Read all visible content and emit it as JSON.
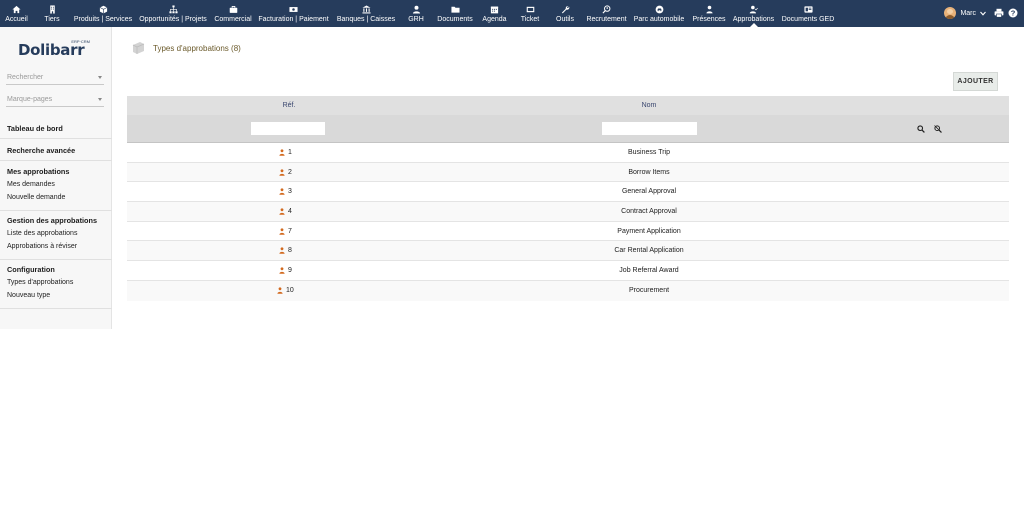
{
  "nav": [
    {
      "label": "Accueil",
      "icon": "home-icon"
    },
    {
      "label": "Tiers",
      "icon": "building-icon"
    },
    {
      "label": "Produits | Services",
      "icon": "cube-icon"
    },
    {
      "label": "Opportunités | Projets",
      "icon": "sitemap-icon"
    },
    {
      "label": "Commercial",
      "icon": "briefcase-icon"
    },
    {
      "label": "Facturation | Paiement",
      "icon": "money-bill-icon"
    },
    {
      "label": "Banques | Caisses",
      "icon": "bank-icon"
    },
    {
      "label": "GRH",
      "icon": "user-icon"
    },
    {
      "label": "Documents",
      "icon": "folder-icon"
    },
    {
      "label": "Agenda",
      "icon": "calendar-icon"
    },
    {
      "label": "Ticket",
      "icon": "ticket-icon"
    },
    {
      "label": "Outils",
      "icon": "wrench-icon"
    },
    {
      "label": "Recrutement",
      "icon": "search-person-icon"
    },
    {
      "label": "Parc automobile",
      "icon": "car-icon"
    },
    {
      "label": "Présences",
      "icon": "users-icon"
    },
    {
      "label": "Approbations",
      "icon": "user-check-icon"
    },
    {
      "label": "Documents GED",
      "icon": "ged-icon"
    }
  ],
  "user": {
    "name": "Marc"
  },
  "sidebar": {
    "logo_text": "Dolibarr",
    "logo_sub": "ERP·CRM",
    "search_placeholder": "Rechercher",
    "bookmarks_placeholder": "Marque-pages",
    "dashboard": "Tableau de bord",
    "advanced_search": "Recherche avancée",
    "sections": [
      {
        "title": "Mes approbations",
        "links": [
          "Mes demandes",
          "Nouvelle demande"
        ]
      },
      {
        "title": "Gestion des approbations",
        "links": [
          "Liste des approbations",
          "Approbations à réviser"
        ]
      },
      {
        "title": "Configuration",
        "links": [
          "Types d'approbations",
          "Nouveau type"
        ]
      }
    ]
  },
  "main": {
    "title": "Types d'approbations (8)",
    "add_button": "AJOUTER",
    "columns": {
      "ref": "Réf.",
      "name": "Nom"
    },
    "rows": [
      {
        "ref": "1",
        "name": "Business Trip"
      },
      {
        "ref": "2",
        "name": "Borrow Items"
      },
      {
        "ref": "3",
        "name": "General Approval"
      },
      {
        "ref": "4",
        "name": "Contract Approval"
      },
      {
        "ref": "7",
        "name": "Payment Application"
      },
      {
        "ref": "8",
        "name": "Car Rental Application"
      },
      {
        "ref": "9",
        "name": "Job Referral Award"
      },
      {
        "ref": "10",
        "name": "Procurement"
      }
    ]
  },
  "colors": {
    "topbar": "#263c5c",
    "ref_icon": "#d2691e",
    "title": "#6b5a2b"
  }
}
